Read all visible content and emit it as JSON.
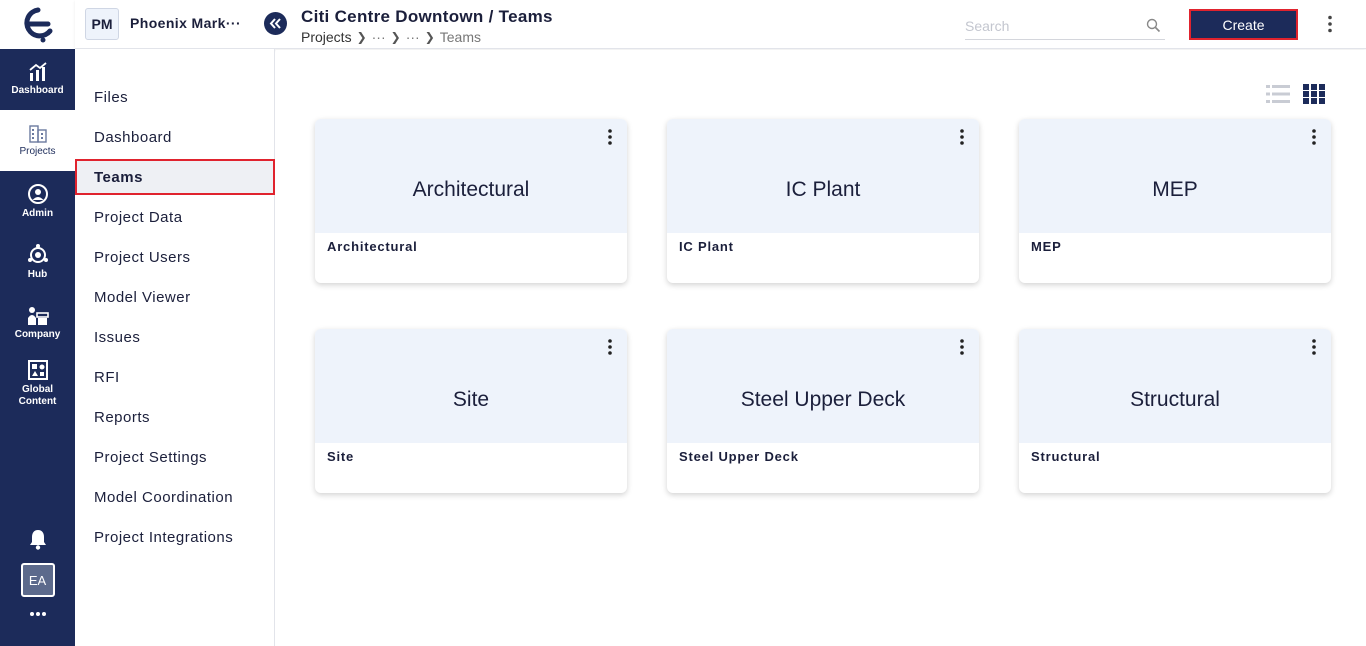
{
  "rail": {
    "items": [
      {
        "label": "Dashboard",
        "icon": "chart-icon"
      },
      {
        "label": "Projects",
        "icon": "buildings-icon"
      },
      {
        "label": "Admin",
        "icon": "admin-icon"
      },
      {
        "label": "Hub",
        "icon": "hub-icon"
      },
      {
        "label": "Company",
        "icon": "company-icon"
      },
      {
        "label": "Global Content",
        "icon": "global-content-icon"
      }
    ],
    "avatar": "EA",
    "colors": {
      "rail_bg": "#1c2b5a",
      "accent_red": "#e0232e"
    }
  },
  "header": {
    "project_badge": "PM",
    "project_name": "Phoenix Mark···",
    "title": "Citi Centre Downtown / Teams",
    "breadcrumb": [
      "Projects",
      "···",
      "···",
      "Teams"
    ],
    "search_placeholder": "Search",
    "create_label": "Create"
  },
  "subnav": {
    "items": [
      "Files",
      "Dashboard",
      "Teams",
      "Project Data",
      "Project Users",
      "Model Viewer",
      "Issues",
      "RFI",
      "Reports",
      "Project Settings",
      "Model Coordination",
      "Project Integrations"
    ],
    "active": "Teams"
  },
  "teams": [
    {
      "title": "Architectural",
      "label": "Architectural"
    },
    {
      "title": "IC Plant",
      "label": "IC Plant"
    },
    {
      "title": "MEP",
      "label": "MEP"
    },
    {
      "title": "Site",
      "label": "Site"
    },
    {
      "title": "Steel Upper Deck",
      "label": "Steel Upper Deck"
    },
    {
      "title": "Structural",
      "label": "Structural"
    }
  ]
}
